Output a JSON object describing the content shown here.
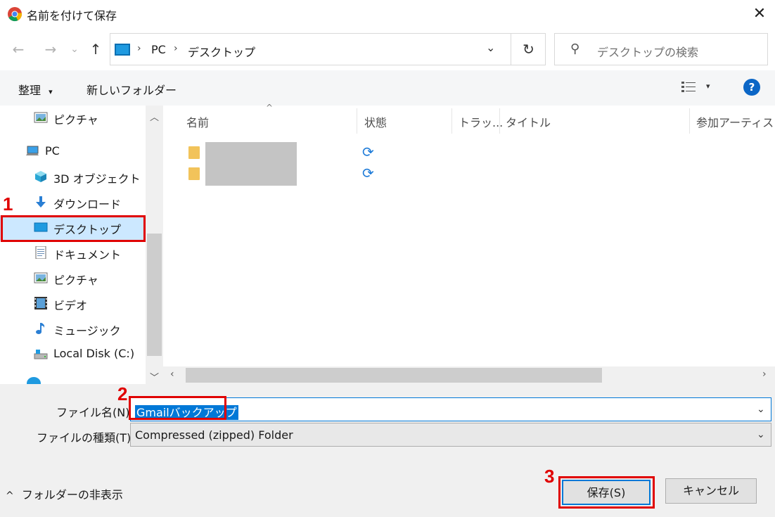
{
  "window": {
    "title": "名前を付けて保存",
    "close_glyph": "✕"
  },
  "nav": {
    "back": "←",
    "forward": "→",
    "recent": "⌄",
    "up": "↑",
    "breadcrumb": [
      "PC",
      "デスクトップ"
    ],
    "sep": "›",
    "refresh": "↻",
    "search_placeholder": "デスクトップの検索"
  },
  "toolbar": {
    "organize": "整理",
    "organize_caret": "▾",
    "new_folder": "新しいフォルダー",
    "help": "?"
  },
  "sidebar": {
    "items": [
      {
        "label": "ピクチャ",
        "icon": "pictures-icon"
      },
      {
        "label": "PC",
        "icon": "pc-icon"
      },
      {
        "label": "3D オブジェクト",
        "icon": "3d-objects-icon"
      },
      {
        "label": "ダウンロード",
        "icon": "download-icon"
      },
      {
        "label": "デスクトップ",
        "icon": "desktop-icon",
        "selected": true
      },
      {
        "label": "ドキュメント",
        "icon": "documents-icon"
      },
      {
        "label": "ピクチャ",
        "icon": "pictures-icon"
      },
      {
        "label": "ビデオ",
        "icon": "video-icon"
      },
      {
        "label": "ミュージック",
        "icon": "music-icon"
      },
      {
        "label": "Local Disk (C:)",
        "icon": "disk-icon"
      }
    ],
    "scroll_up": "︿",
    "scroll_down": "﹀"
  },
  "columns": [
    "名前",
    "状態",
    "トラッ...",
    "タイトル",
    "参加アーティスト"
  ],
  "sort_indicator": "^",
  "files": [
    {
      "status_icon": "sync-icon",
      "status_glyph": "⟳"
    },
    {
      "status_icon": "sync-icon",
      "status_glyph": "⟳"
    }
  ],
  "form": {
    "filename_label": "ファイル名(N):",
    "filename_value": "Gmailバックアップ",
    "filetype_label": "ファイルの種類(T):",
    "filetype_value": "Compressed (zipped) Folder",
    "caret": "⌄"
  },
  "footer": {
    "hide_folders": "フォルダーの非表示",
    "hide_caret": "^",
    "save": "保存(S)",
    "cancel": "キャンセル"
  },
  "annotations": [
    "1",
    "2",
    "3"
  ],
  "colors": {
    "accent": "#0078d7",
    "annotation_red": "#e00000",
    "selected_bg": "#cce8ff"
  }
}
